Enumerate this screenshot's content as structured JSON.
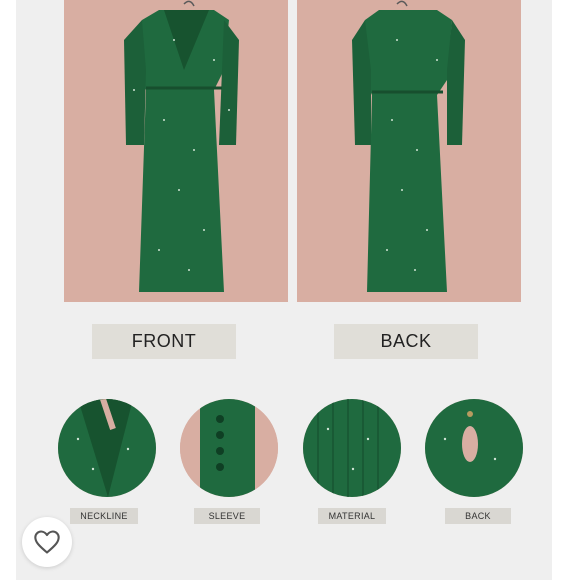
{
  "colors": {
    "background": "#efefef",
    "photo_bg": "#d8aea2",
    "dress_green": "#1f6a3f",
    "label_bg": "#e0ded8"
  },
  "views": {
    "front_label": "FRONT",
    "back_label": "BACK"
  },
  "details": [
    {
      "label": "NECKLINE"
    },
    {
      "label": "SLEEVE"
    },
    {
      "label": "MATERIAL"
    },
    {
      "label": "BACK"
    }
  ],
  "like_button": {
    "icon": "heart-outline-icon"
  }
}
